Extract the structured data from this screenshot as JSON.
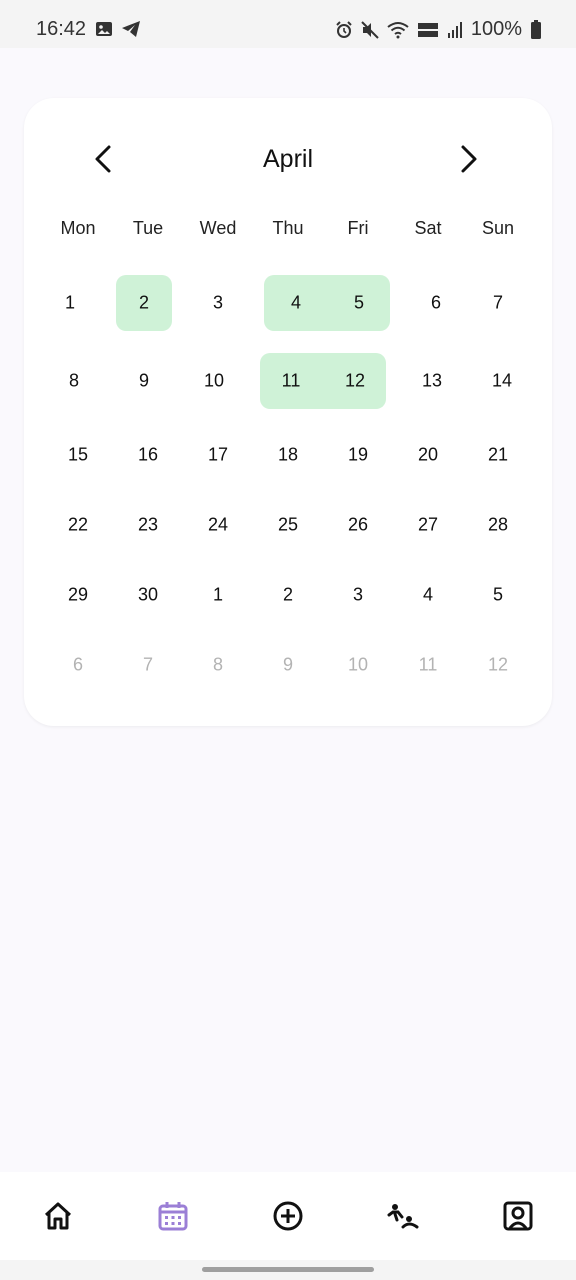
{
  "status_bar": {
    "time": "16:42",
    "battery_text": "100%",
    "left_icons": [
      "image-icon",
      "telegram-icon"
    ],
    "right_icons": [
      "alarm-icon",
      "mute-icon",
      "wifi-icon",
      "volte-icon",
      "signal-icon",
      "battery-icon"
    ]
  },
  "calendar": {
    "month": "April",
    "weekdays": [
      "Mon",
      "Tue",
      "Wed",
      "Thu",
      "Fri",
      "Sat",
      "Sun"
    ],
    "highlight_color": "#cff2d7",
    "weeks": [
      [
        {
          "label": "1"
        },
        {
          "label": "2",
          "highlighted": true
        },
        {
          "label": "3"
        },
        {
          "label": "4",
          "highlighted": true
        },
        {
          "label": "5",
          "highlighted": true
        },
        {
          "label": "6"
        },
        {
          "label": "7"
        }
      ],
      [
        {
          "label": "8"
        },
        {
          "label": "9"
        },
        {
          "label": "10"
        },
        {
          "label": "11",
          "highlighted": true
        },
        {
          "label": "12",
          "highlighted": true
        },
        {
          "label": "13"
        },
        {
          "label": "14"
        }
      ],
      [
        {
          "label": "15"
        },
        {
          "label": "16"
        },
        {
          "label": "17"
        },
        {
          "label": "18"
        },
        {
          "label": "19"
        },
        {
          "label": "20"
        },
        {
          "label": "21"
        }
      ],
      [
        {
          "label": "22"
        },
        {
          "label": "23"
        },
        {
          "label": "24"
        },
        {
          "label": "25"
        },
        {
          "label": "26"
        },
        {
          "label": "27"
        },
        {
          "label": "28"
        }
      ],
      [
        {
          "label": "29"
        },
        {
          "label": "30"
        },
        {
          "label": "1"
        },
        {
          "label": "2"
        },
        {
          "label": "3"
        },
        {
          "label": "4"
        },
        {
          "label": "5"
        }
      ],
      [
        {
          "label": "6",
          "muted": true
        },
        {
          "label": "7",
          "muted": true
        },
        {
          "label": "8",
          "muted": true
        },
        {
          "label": "9",
          "muted": true
        },
        {
          "label": "10",
          "muted": true
        },
        {
          "label": "11",
          "muted": true
        },
        {
          "label": "12",
          "muted": true
        }
      ]
    ]
  },
  "bottom_nav": {
    "active_color": "#9b7fd6",
    "items": [
      {
        "icon": "home-icon",
        "active": false
      },
      {
        "icon": "calendar-icon",
        "active": true
      },
      {
        "icon": "add-circle-icon",
        "active": false
      },
      {
        "icon": "people-icon",
        "active": false
      },
      {
        "icon": "profile-icon",
        "active": false
      }
    ]
  }
}
